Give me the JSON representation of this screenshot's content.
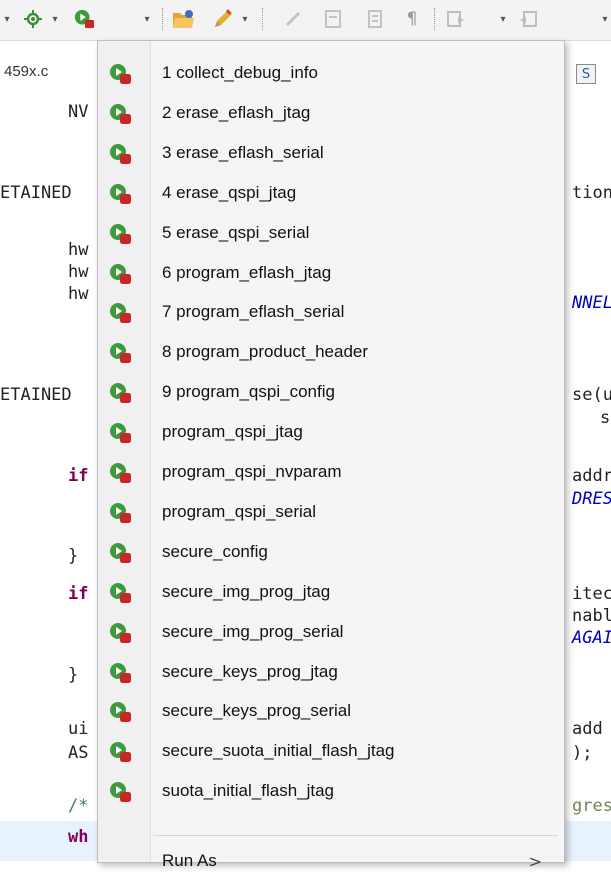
{
  "editor_tab": {
    "label": "459x.c",
    "right_badge": "S"
  },
  "toolbar": {
    "icons": [
      "gear-icon",
      "debug-tool-icon",
      "folder-open-icon",
      "pencil-icon",
      "edit-icon",
      "pilcrow-icon",
      "navigate-icon"
    ],
    "arrow_glyph": "▾"
  },
  "code": {
    "lines": [
      {
        "left": "NV",
        "right": ""
      },
      {
        "left": "ETAINED",
        "right": "tion"
      },
      {
        "left": "hw",
        "right": ""
      },
      {
        "left": "hw",
        "right": ""
      },
      {
        "left": "hw",
        "right": "NNEL"
      },
      {
        "left": "ETAINED",
        "right": "se(u"
      },
      {
        "left": "",
        "right": "s"
      },
      {
        "left": "if",
        "right": "addr"
      },
      {
        "left": "",
        "right": "DRES"
      },
      {
        "left": "}",
        "right": ""
      },
      {
        "left": "if",
        "right": "itec"
      },
      {
        "left": "",
        "right": "nabl"
      },
      {
        "left": "",
        "right": "AGAI"
      },
      {
        "left": "}",
        "right": ""
      },
      {
        "left": "ui",
        "right": "add"
      },
      {
        "left": "AS",
        "right": ");"
      },
      {
        "left": "/*",
        "right": "gres"
      },
      {
        "left": "wh",
        "right": ""
      }
    ]
  },
  "menu": {
    "items": [
      {
        "label": "1 collect_debug_info"
      },
      {
        "label": "2 erase_eflash_jtag"
      },
      {
        "label": "3 erase_eflash_serial"
      },
      {
        "label": "4 erase_qspi_jtag"
      },
      {
        "label": "5 erase_qspi_serial"
      },
      {
        "label": "6 program_eflash_jtag"
      },
      {
        "label": "7 program_eflash_serial"
      },
      {
        "label": "8 program_product_header"
      },
      {
        "label": "9 program_qspi_config"
      },
      {
        "label": "program_qspi_jtag"
      },
      {
        "label": "program_qspi_nvparam"
      },
      {
        "label": "program_qspi_serial"
      },
      {
        "label": "secure_config"
      },
      {
        "label": "secure_img_prog_jtag"
      },
      {
        "label": "secure_img_prog_serial"
      },
      {
        "label": "secure_keys_prog_jtag"
      },
      {
        "label": "secure_keys_prog_serial"
      },
      {
        "label": "secure_suota_initial_flash_jtag"
      },
      {
        "label": "suota_initial_flash_jtag"
      }
    ],
    "run_as": {
      "label": "Run As",
      "arrow": ">"
    },
    "item_icon": "external-tool-run-icon"
  }
}
